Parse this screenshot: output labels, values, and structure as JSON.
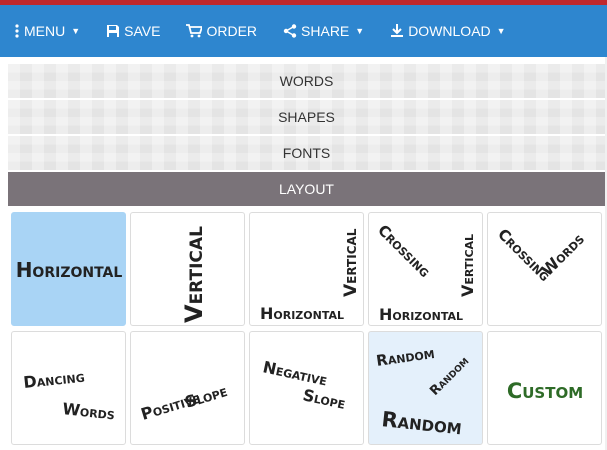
{
  "toolbar": {
    "menu_label": "MENU",
    "save_label": "SAVE",
    "order_label": "ORDER",
    "share_label": "SHARE",
    "download_label": "DOWNLOAD"
  },
  "accordion": {
    "words": "WORDS",
    "shapes": "SHAPES",
    "fonts": "FONTS",
    "layout": "LAYOUT"
  },
  "layouts": {
    "horizontal": {
      "line1": "Horizontal"
    },
    "vertical": {
      "line1": "Vertical"
    },
    "horizontal_vertical": {
      "line1": "Vertical",
      "line2": "Horizontal"
    },
    "crossing_vertical_horizontal": {
      "line1": "Crossing",
      "line2": "Vertical",
      "line3": "Horizontal"
    },
    "crossing_words": {
      "line1": "Crossing",
      "line2": "Words"
    },
    "dancing_words": {
      "line1": "Dancing",
      "line2": "Words"
    },
    "positive_slope": {
      "line1": "Positive",
      "line2": "Slope"
    },
    "negative_slope": {
      "line1": "Negative",
      "line2": "Slope"
    },
    "random": {
      "line1": "Random",
      "line2": "Random",
      "line3": "Random"
    },
    "custom": {
      "line1": "Custom"
    }
  },
  "colors": {
    "toolbar": "#2e86cf",
    "top_line": "#c0282d",
    "active_section": "#7a7379",
    "selected_tile": "#a9d4f5",
    "custom_text": "#2e6b27"
  },
  "selected_layout": "Horizontal"
}
